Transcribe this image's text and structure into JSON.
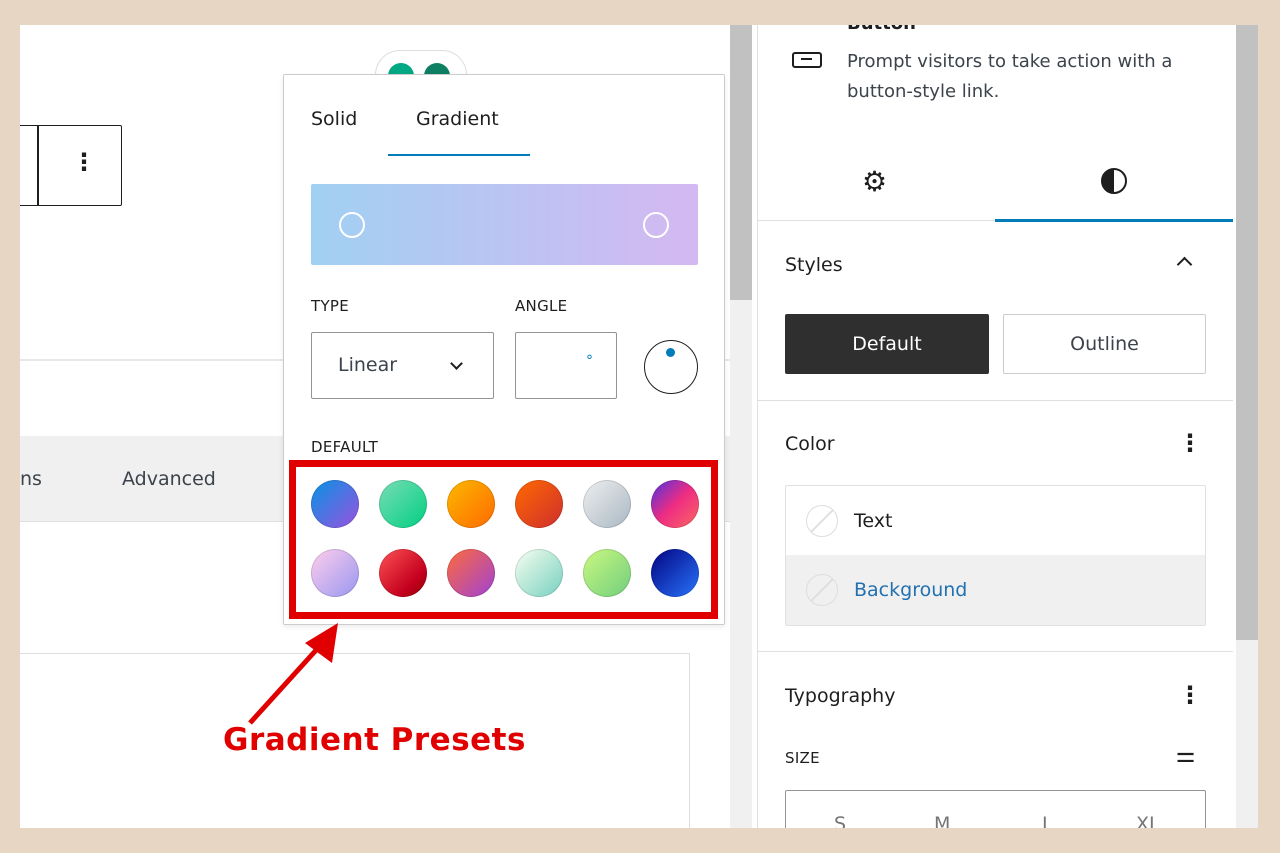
{
  "editor": {
    "tabs_partial": "ns",
    "tab_advanced": "Advanced"
  },
  "popover": {
    "tabs": [
      {
        "label": "Solid"
      },
      {
        "label": "Gradient",
        "active": true
      }
    ],
    "gradient_preview": {
      "from": "#a1d0f3",
      "to": "#d4b8f1"
    },
    "type_label": "TYPE",
    "type_value": "Linear",
    "angle_label": "ANGLE",
    "angle_unit": "°",
    "default_label": "DEFAULT",
    "presets": [
      "linear-gradient(135deg,#0693e3,#9b51e0)",
      "linear-gradient(135deg,#7adcb4,#00d082)",
      "linear-gradient(135deg,#fcb900,#ff6900)",
      "linear-gradient(135deg,#ff6900,#cf2e2e)",
      "linear-gradient(135deg,#eee,#a9b8c3)",
      "linear-gradient(135deg,#4b33e3,#ee2c82 50%,#fb6962)",
      "linear-gradient(135deg,#ffceec,#9896f0)",
      "linear-gradient(135deg,#fe5255,#c4001e 70%,#8e0000)",
      "linear-gradient(135deg,#ff6b3a,#9f42d6)",
      "linear-gradient(135deg,#ffffff,#d0f0e0 30%,#76d0c0)",
      "linear-gradient(135deg,#caf880,#71ce7e)",
      "linear-gradient(135deg,#020381,#2874fc)"
    ]
  },
  "annotation": {
    "label": "Gradient Presets",
    "color": "#e00000"
  },
  "sidebar": {
    "block_title": "Button",
    "block_description": "Prompt visitors to take action with a button-style link.",
    "tabs": [
      {
        "icon": "gear-icon"
      },
      {
        "icon": "contrast-icon",
        "active": true
      }
    ],
    "styles_title": "Styles",
    "style_default": "Default",
    "style_outline": "Outline",
    "color_title": "Color",
    "color_text": "Text",
    "color_background": "Background",
    "typography_title": "Typography",
    "size_label": "SIZE",
    "sizes": [
      "S",
      "M",
      "L",
      "XL"
    ]
  },
  "accent": "#007cba"
}
